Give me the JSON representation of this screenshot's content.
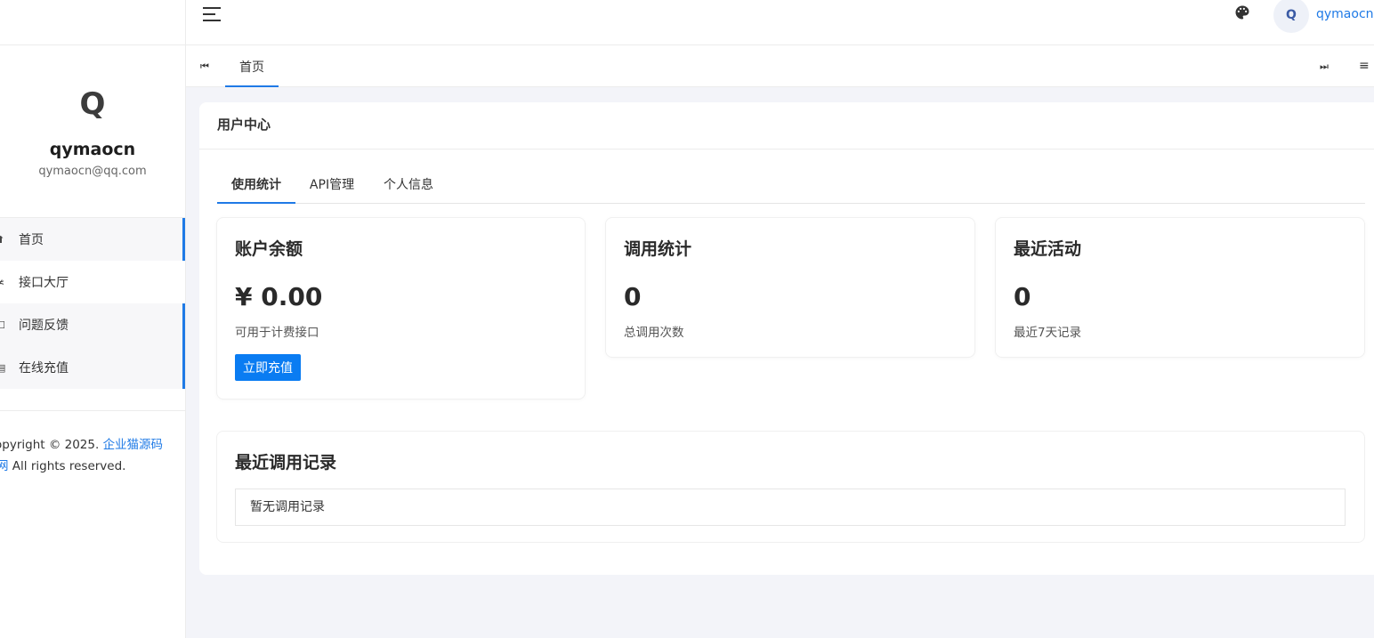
{
  "sidebar": {
    "avatar_letter": "Q",
    "username": "qymaocn",
    "email": "qymaocn@qq.com",
    "items": [
      {
        "icon": "home-icon",
        "glyph": "⬆",
        "label": "首页"
      },
      {
        "icon": "api-icon",
        "glyph": "≭",
        "label": "接口大厅"
      },
      {
        "icon": "feedback-icon",
        "glyph": "☐",
        "label": "问题反馈"
      },
      {
        "icon": "recharge-icon",
        "glyph": "▤",
        "label": "在线充值"
      }
    ],
    "footer": {
      "copyright_prefix": "opyright © 2025. ",
      "brand_link": "企业猫源码",
      "line2_link": "网",
      "line2_text": " All rights reserved."
    }
  },
  "header": {
    "user_avatar_letter": "Q",
    "username": "qymaocn"
  },
  "tabbar": {
    "prev_glyph": "⏮",
    "tab_label": "首页",
    "next_glyph": "⏭",
    "menu_glyph": "≡"
  },
  "main": {
    "title": "用户中心",
    "tabs": [
      {
        "label": "使用统计",
        "active": true
      },
      {
        "label": "API管理",
        "active": false
      },
      {
        "label": "个人信息",
        "active": false
      }
    ],
    "cards": [
      {
        "title": "账户余额",
        "value": "¥ 0.00",
        "desc": "可用于计费接口",
        "button": "立即充值"
      },
      {
        "title": "调用统计",
        "value": "0",
        "desc": "总调用次数"
      },
      {
        "title": "最近活动",
        "value": "0",
        "desc": "最近7天记录"
      }
    ],
    "records": {
      "title": "最近调用记录",
      "empty_text": "暂无调用记录"
    }
  },
  "colors": {
    "accent": "#1f7ae6",
    "button": "#0a7cf2",
    "background": "#f3f4f9"
  }
}
